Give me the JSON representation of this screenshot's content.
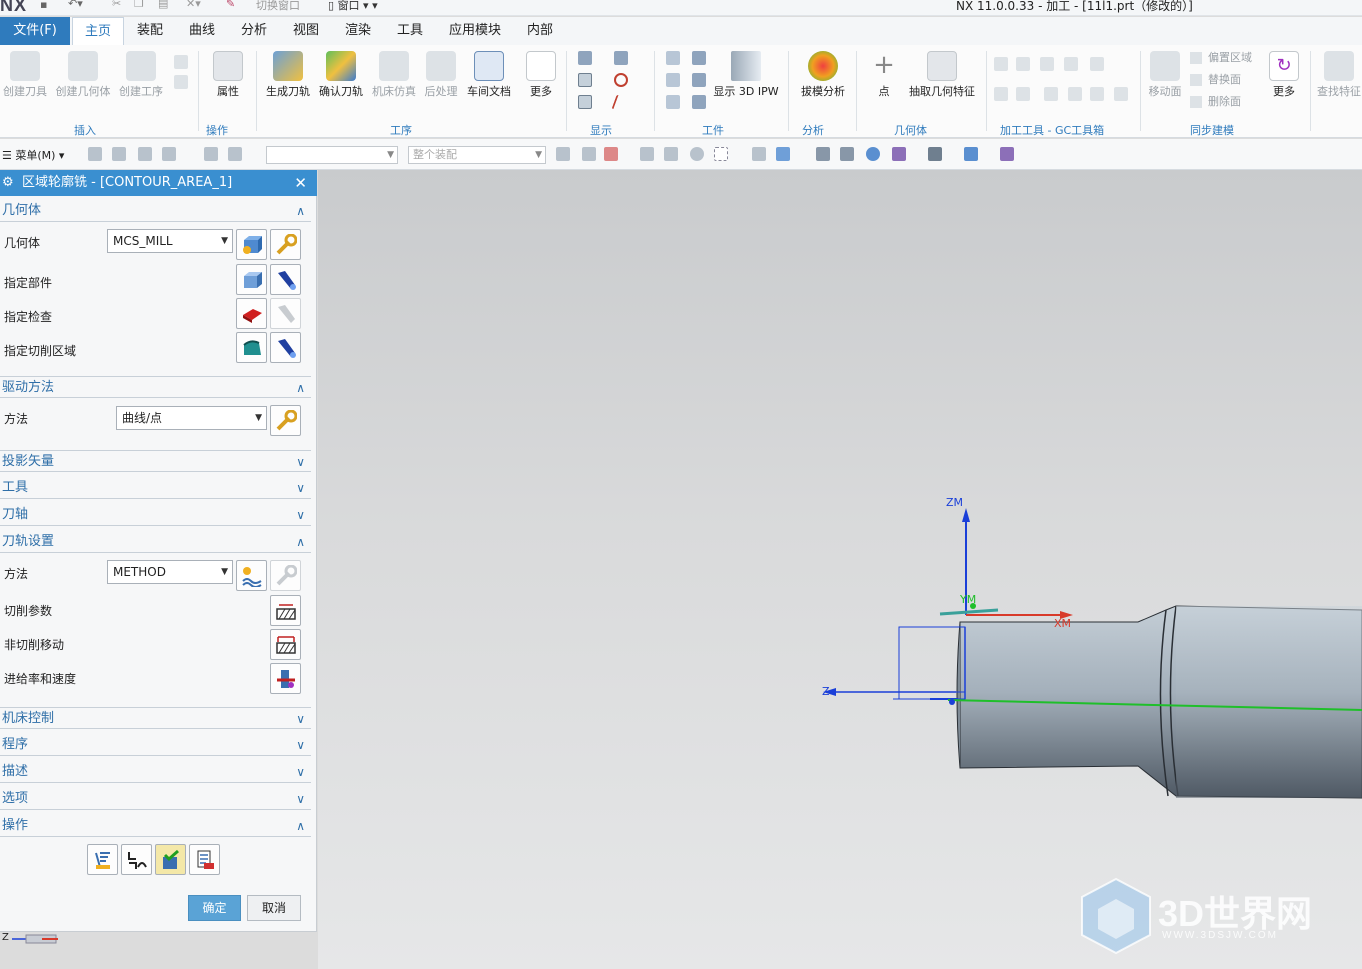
{
  "window": {
    "logo": "NX",
    "title": "NX 11.0.0.33 - 加工 - [11l1.prt（修改的）]",
    "switch_window": "切换窗口",
    "window_menu": "窗口"
  },
  "tabs": [
    {
      "label": "文件(F)"
    },
    {
      "label": "主页"
    },
    {
      "label": "装配"
    },
    {
      "label": "曲线"
    },
    {
      "label": "分析"
    },
    {
      "label": "视图"
    },
    {
      "label": "渲染"
    },
    {
      "label": "工具"
    },
    {
      "label": "应用模块"
    },
    {
      "label": "内部"
    }
  ],
  "ribbon": {
    "insert": {
      "create_tool": "创建刀具",
      "create_geometry": "创建几何体",
      "create_operation": "创建工序",
      "group": "插入"
    },
    "operation": {
      "properties": "属性",
      "group": "操作"
    },
    "procedure": {
      "generate": "生成刀轨",
      "verify": "确认刀轨",
      "simulate": "机床仿真",
      "postprocess": "后处理",
      "shop_doc": "车间文档",
      "more": "更多",
      "group": "工序"
    },
    "display": {
      "group": "显示"
    },
    "workpiece": {
      "show_ipw": "显示 3D IPW",
      "group": "工件"
    },
    "analysis": {
      "draft": "拔模分析",
      "group": "分析"
    },
    "geometry": {
      "point": "点",
      "extract": "抽取几何特征",
      "group": "几何体"
    },
    "gc": {
      "group": "加工工具 - GC工具箱"
    },
    "sync": {
      "move_face": "移动面",
      "offset_region": "偏置区域",
      "replace_face": "替换面",
      "delete_face": "删除面",
      "more": "更多",
      "group": "同步建模"
    },
    "find": {
      "find_feature": "查找特征"
    }
  },
  "toolbar": {
    "menu": "菜单(M)",
    "filter_placeholder": "",
    "assembly_scope": "整个装配"
  },
  "dialog": {
    "title": "区域轮廓铣 - [CONTOUR_AREA_1]",
    "geometry": {
      "header": "几何体",
      "geometry_label": "几何体",
      "geometry_value": "MCS_MILL",
      "part_label": "指定部件",
      "check_label": "指定检查",
      "cut_area_label": "指定切削区域"
    },
    "drive": {
      "header": "驱动方法",
      "method_label": "方法",
      "method_value": "曲线/点"
    },
    "projection_header": "投影矢量",
    "tool_header": "工具",
    "axis_header": "刀轴",
    "path": {
      "header": "刀轨设置",
      "method_label": "方法",
      "method_value": "METHOD",
      "cut_params": "切削参数",
      "non_cut": "非切削移动",
      "feeds": "进给率和速度"
    },
    "machine_header": "机床控制",
    "program_header": "程序",
    "description_header": "描述",
    "options_header": "选项",
    "actions_header": "操作",
    "ok": "确定",
    "cancel": "取消"
  },
  "viewport": {
    "axis_zm": "ZM",
    "axis_xm": "XM",
    "axis_ym": "YM",
    "axis_z": "Z",
    "triad_z": "Z"
  },
  "watermark": {
    "brand": "3D世界网",
    "url": "WWW.3DSJW.COM"
  },
  "colors": {
    "accent": "#2f7bbd",
    "dialog_title": "#3a8fd0",
    "ok_button": "#5aa3d6",
    "toolpath": "#1a3fd8",
    "xm_axis": "#d83a2a",
    "centerline": "#1fbf2a"
  }
}
